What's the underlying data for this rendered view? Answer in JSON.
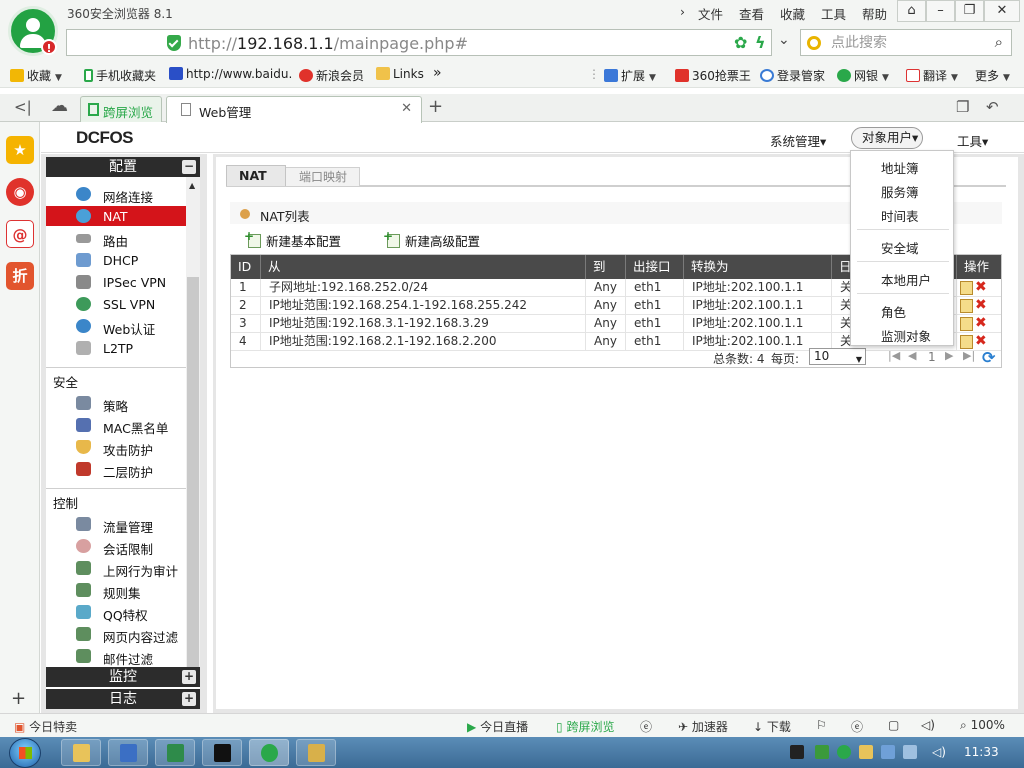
{
  "browser": {
    "title": "360安全浏览器 8.1",
    "menu": [
      "文件",
      "查看",
      "收藏",
      "工具",
      "帮助"
    ],
    "url_host": "192.168.1.1",
    "url_path": "/mainpage.php#",
    "url_scheme": "http://",
    "search_placeholder": "点此搜索",
    "favorites": [
      {
        "label": "收藏"
      },
      {
        "label": "手机收藏夹"
      },
      {
        "label": "http://www.baidu."
      },
      {
        "label": "新浪会员"
      },
      {
        "label": "Links"
      }
    ],
    "toolbar_right": [
      {
        "label": "扩展"
      },
      {
        "label": "360抢票王"
      },
      {
        "label": "登录管家"
      },
      {
        "label": "网银"
      },
      {
        "label": "翻译"
      },
      {
        "label": "更多"
      }
    ],
    "tabs": [
      {
        "label": "跨屏浏览"
      },
      {
        "label": "Web管理"
      }
    ],
    "statusbar": {
      "left": "今日特卖",
      "items": [
        "今日直播",
        "跨屏浏览",
        "加速器",
        "下载"
      ],
      "zoom": "100%"
    }
  },
  "app": {
    "brand": "DCFOS",
    "topmenu": [
      "系统管理",
      "对象用户",
      "工具"
    ],
    "dropdown": [
      "地址簿",
      "服务簿",
      "时间表",
      "安全域",
      "本地用户",
      "角色",
      "监测对象"
    ],
    "nav": {
      "config_header": "配置",
      "config_items": [
        "网络连接",
        "NAT",
        "路由",
        "DHCP",
        "IPSec VPN",
        "SSL VPN",
        "Web认证",
        "L2TP"
      ],
      "security_header": "安全",
      "security_items": [
        "策略",
        "MAC黑名单",
        "攻击防护",
        "二层防护"
      ],
      "control_header": "控制",
      "control_items": [
        "流量管理",
        "会话限制",
        "上网行为审计",
        "规则集",
        "QQ特权",
        "网页内容过滤",
        "邮件过滤"
      ],
      "monitor_header": "监控",
      "log_header": "日志",
      "active": "NAT"
    },
    "subtabs": [
      "NAT",
      "端口映射"
    ],
    "list_title": "NAT列表",
    "actions": [
      "新建基本配置",
      "新建高级配置"
    ],
    "grid": {
      "columns": [
        "ID",
        "从",
        "到",
        "出接口",
        "转换为",
        "日",
        "操作"
      ],
      "rows": [
        {
          "id": "1",
          "from": "子网地址:192.168.252.0/24",
          "to": "Any",
          "iface": "eth1",
          "trans": "IP地址:202.100.1.1",
          "log": "关"
        },
        {
          "id": "2",
          "from": "IP地址范围:192.168.254.1-192.168.255.242",
          "to": "Any",
          "iface": "eth1",
          "trans": "IP地址:202.100.1.1",
          "log": "关"
        },
        {
          "id": "3",
          "from": "IP地址范围:192.168.3.1-192.168.3.29",
          "to": "Any",
          "iface": "eth1",
          "trans": "IP地址:202.100.1.1",
          "log": "关"
        },
        {
          "id": "4",
          "from": "IP地址范围:192.168.2.1-192.168.2.200",
          "to": "Any",
          "iface": "eth1",
          "trans": "IP地址:202.100.1.1",
          "log": "关"
        }
      ],
      "total_label": "总条数: 4",
      "perpage_label": "每页:",
      "perpage_value": "10",
      "page": "1"
    }
  },
  "taskbar": {
    "clock": "11:33"
  }
}
